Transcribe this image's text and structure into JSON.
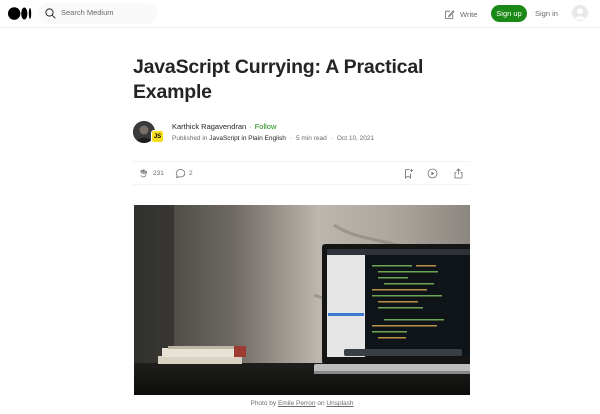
{
  "header": {
    "search_placeholder": "Search Medium",
    "write_label": "Write",
    "signup_label": "Sign up",
    "signin_label": "Sign in"
  },
  "article": {
    "title": "JavaScript Currying: A Practical Example",
    "author_name": "Karthick Ragavendran",
    "follow_label": "Follow",
    "published_in_label": "Published in",
    "publication": "JavaScript in Plain English",
    "publication_badge": "JS",
    "read_time": "5 min read",
    "date": "Oct 10, 2021",
    "claps": "231",
    "responses": "2"
  },
  "image": {
    "caption_prefix": "Photo by",
    "photographer": "Emile Perron",
    "caption_on": "on",
    "source": "Unsplash"
  },
  "colors": {
    "brand_green": "#1a8917",
    "js_yellow": "#f7df1e",
    "text_primary": "#242424",
    "text_secondary": "#6b6b6b"
  }
}
